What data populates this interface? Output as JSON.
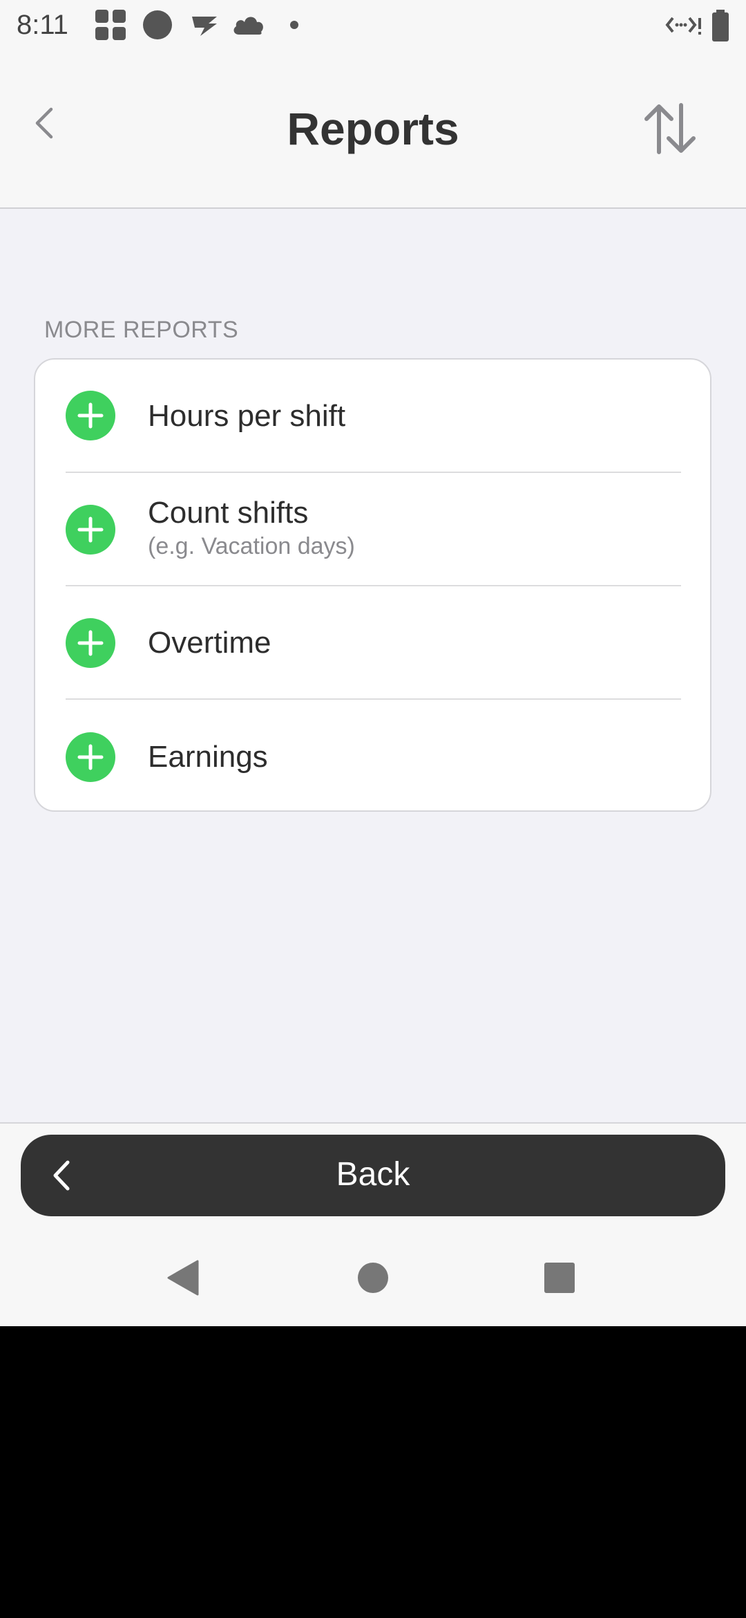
{
  "status_bar": {
    "time": "8:11"
  },
  "header": {
    "title": "Reports"
  },
  "section": {
    "label": "MORE REPORTS"
  },
  "reports": [
    {
      "label": "Hours per shift",
      "sub": ""
    },
    {
      "label": "Count shifts",
      "sub": "(e.g. Vacation days)"
    },
    {
      "label": "Overtime",
      "sub": ""
    },
    {
      "label": "Earnings",
      "sub": ""
    }
  ],
  "bottom": {
    "back_label": "Back"
  },
  "colors": {
    "accent_green": "#3fd05e",
    "button_dark": "#333333"
  },
  "icons": [
    "back-chevron-icon",
    "sort-icon",
    "add-icon",
    "nav-back-icon",
    "nav-home-icon",
    "nav-recents-icon"
  ]
}
